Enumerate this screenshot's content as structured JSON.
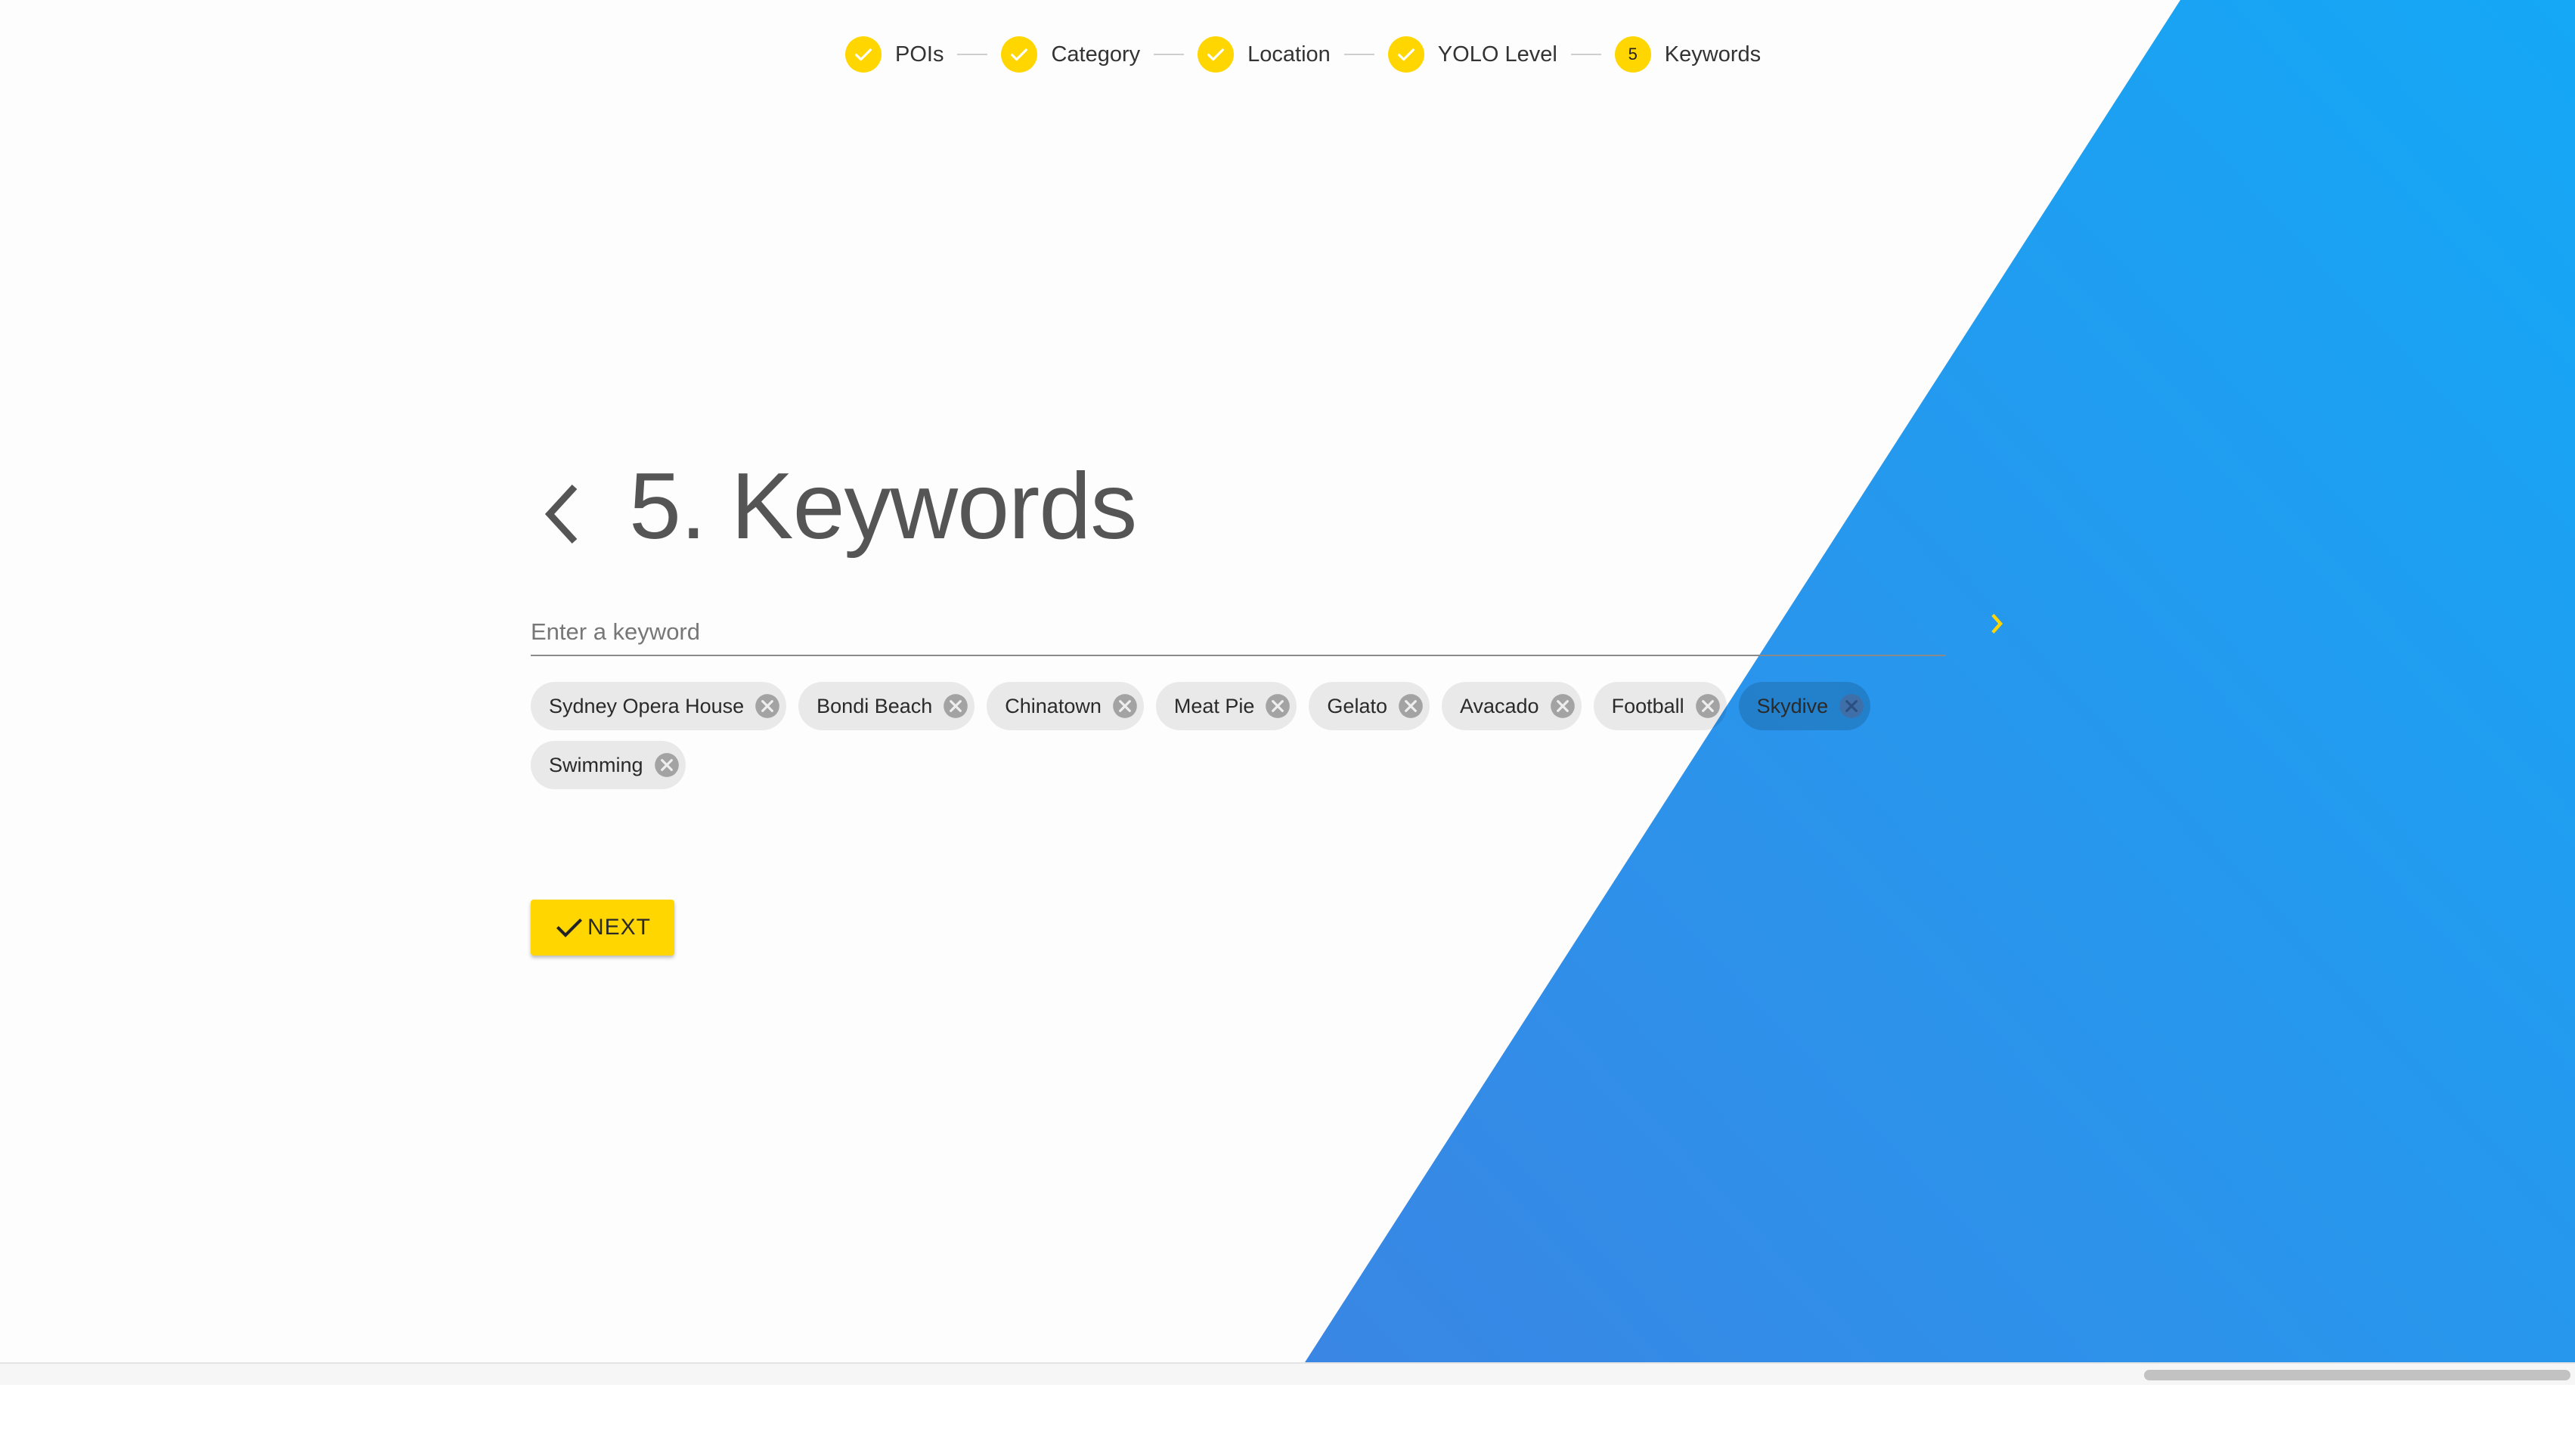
{
  "stepper": {
    "steps": [
      {
        "label": "POIs",
        "state": "done",
        "icon": "check-icon"
      },
      {
        "label": "Category",
        "state": "done",
        "icon": "check-icon"
      },
      {
        "label": "Location",
        "state": "done",
        "icon": "check-icon"
      },
      {
        "label": "YOLO Level",
        "state": "done",
        "icon": "check-icon"
      },
      {
        "label": "Keywords",
        "state": "current",
        "number": "5"
      }
    ]
  },
  "page": {
    "title": "5. Keywords",
    "back_icon": "chevron-left-icon"
  },
  "keyword_input": {
    "placeholder": "Enter a keyword",
    "value": "",
    "submit_icon": "chevron-right-icon"
  },
  "keywords": [
    {
      "label": "Sydney Opera House",
      "selected": false
    },
    {
      "label": "Bondi Beach",
      "selected": false
    },
    {
      "label": "Chinatown",
      "selected": false
    },
    {
      "label": "Meat Pie",
      "selected": false
    },
    {
      "label": "Gelato",
      "selected": false
    },
    {
      "label": "Avacado",
      "selected": false
    },
    {
      "label": "Football",
      "selected": false
    },
    {
      "label": "Skydive",
      "selected": true
    },
    {
      "label": "Swimming",
      "selected": false
    }
  ],
  "next_button": {
    "label": "NEXT",
    "icon": "check-icon"
  },
  "colors": {
    "accent": "#ffd600",
    "blue_start": "#3a86e4",
    "blue_end": "#14a8f6"
  }
}
